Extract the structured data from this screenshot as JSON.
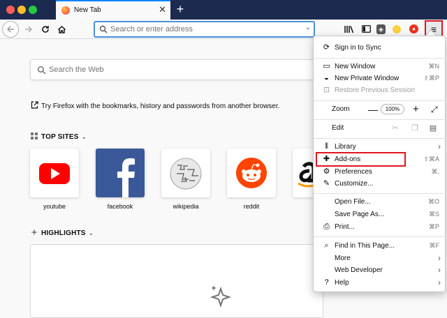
{
  "tab": {
    "title": "New Tab",
    "close": "✕",
    "new_tab": "+"
  },
  "toolbar": {
    "url_placeholder": "Search or enter address",
    "menu_icon": "≡"
  },
  "content": {
    "search_placeholder": "Search the Web",
    "import_text": "Try Firefox with the bookmarks, history and passwords from another browser.",
    "top_sites_title": "TOP SITES",
    "highlights_title": "HIGHLIGHTS",
    "top_sites": [
      {
        "label": "youtube"
      },
      {
        "label": "facebook"
      },
      {
        "label": "wikipedia"
      },
      {
        "label": "reddit"
      },
      {
        "label": "am"
      }
    ]
  },
  "menu": {
    "sign_in": "Sign in to Sync",
    "new_window": {
      "label": "New Window",
      "shortcut": "⌘N"
    },
    "new_private": {
      "label": "New Private Window",
      "shortcut": "⇧⌘P"
    },
    "restore": {
      "label": "Restore Previous Session"
    },
    "zoom": {
      "label": "Zoom",
      "minus": "—",
      "value": "100%",
      "plus": "+"
    },
    "edit": {
      "label": "Edit"
    },
    "library": {
      "label": "Library"
    },
    "addons": {
      "label": "Add-ons",
      "shortcut": "⇧⌘A"
    },
    "preferences": {
      "label": "Preferences",
      "shortcut": "⌘,"
    },
    "customize": {
      "label": "Customize..."
    },
    "open_file": {
      "label": "Open File...",
      "shortcut": "⌘O"
    },
    "save_page": {
      "label": "Save Page As...",
      "shortcut": "⌘S"
    },
    "print": {
      "label": "Print...",
      "shortcut": "⌘P"
    },
    "find": {
      "label": "Find in This Page...",
      "shortcut": "⌘F"
    },
    "more": {
      "label": "More"
    },
    "web_dev": {
      "label": "Web Developer"
    },
    "help": {
      "label": "Help"
    }
  },
  "colors": {
    "titlebar": "#1b2a4e",
    "accent": "#0a84ff",
    "highlight_box": "#e0141e"
  }
}
